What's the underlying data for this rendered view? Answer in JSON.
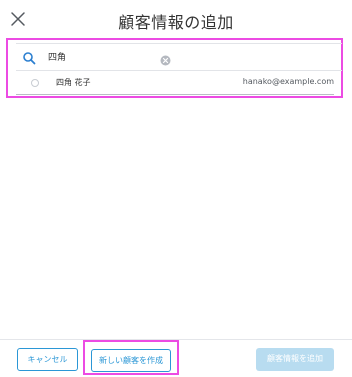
{
  "header": {
    "title": "顧客情報の追加",
    "close_icon": "close-icon"
  },
  "search": {
    "value": "四角",
    "icon": "search-icon",
    "clear_icon": "clear-circle-icon"
  },
  "results": [
    {
      "name": "四角 花子",
      "email": "hanako@example.com"
    }
  ],
  "footer": {
    "cancel_label": "キャンセル",
    "create_label": "新しい顧客を作成",
    "add_label": "顧客情報を追加"
  },
  "colors": {
    "accent": "#2b97d6",
    "highlight": "#ec4be3",
    "disabled_button": "#b8dcf0"
  }
}
